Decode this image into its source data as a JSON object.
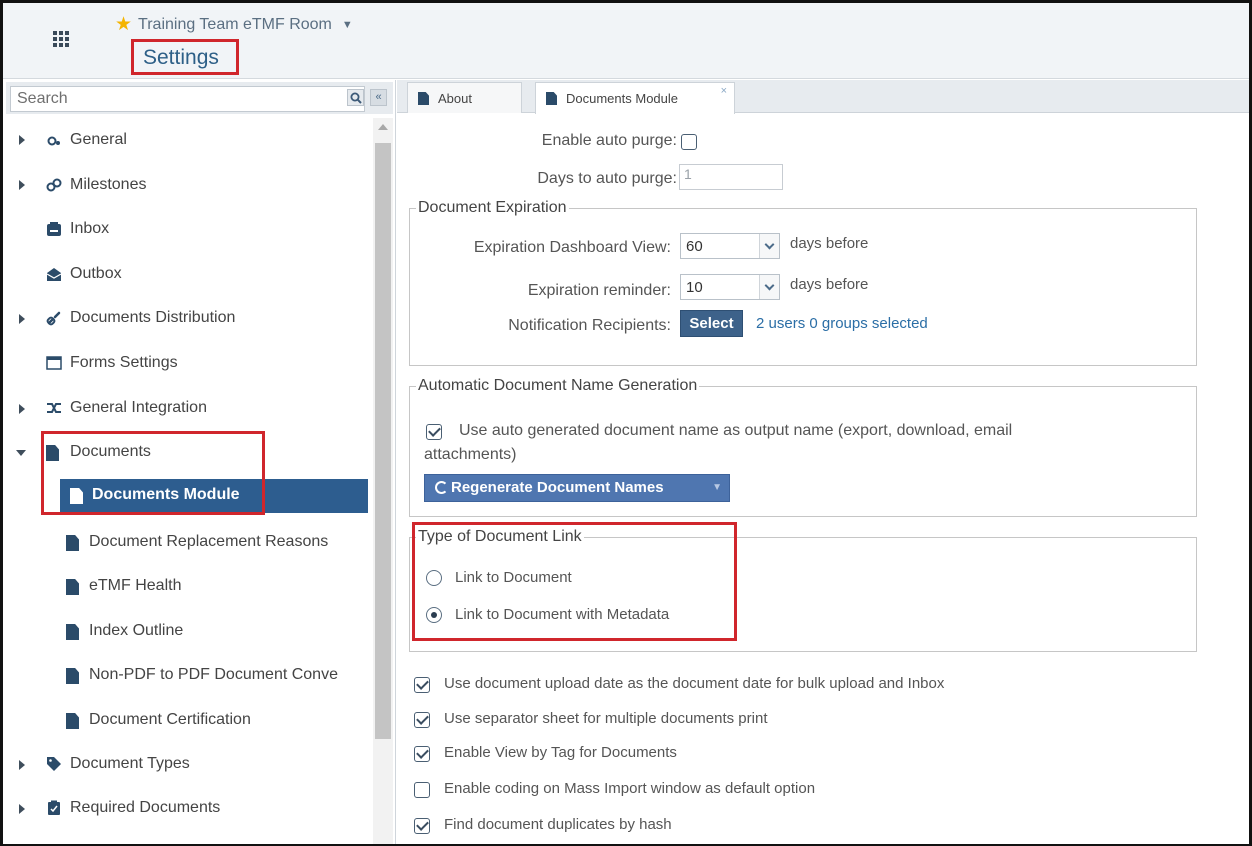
{
  "header": {
    "room_name": "Training Team eTMF Room",
    "page_title": "Settings"
  },
  "sidebar": {
    "search_placeholder": "Search",
    "items": [
      {
        "label": "General",
        "expandable": true
      },
      {
        "label": "Milestones",
        "expandable": true
      },
      {
        "label": "Inbox",
        "expandable": false
      },
      {
        "label": "Outbox",
        "expandable": false
      },
      {
        "label": "Documents Distribution",
        "expandable": true
      },
      {
        "label": "Forms Settings",
        "expandable": false
      },
      {
        "label": "General Integration",
        "expandable": true
      },
      {
        "label": "Documents",
        "expandable": true,
        "expanded": true
      },
      {
        "label": "Documents Module",
        "child": true,
        "selected": true
      },
      {
        "label": "Document Replacement Reasons",
        "child": true
      },
      {
        "label": "eTMF Health",
        "child": true
      },
      {
        "label": "Index Outline",
        "child": true
      },
      {
        "label": "Non-PDF to PDF Document Conve",
        "child": true
      },
      {
        "label": "Document Certification",
        "child": true
      },
      {
        "label": "Document Types",
        "expandable": true
      },
      {
        "label": "Required Documents",
        "expandable": true
      }
    ]
  },
  "tabs": [
    {
      "label": "About"
    },
    {
      "label": "Documents Module",
      "active": true,
      "close_glyph": "×"
    }
  ],
  "form": {
    "auto_purge_label": "Enable auto purge:",
    "auto_purge_checked": false,
    "days_purge_label": "Days to auto purge:",
    "days_purge_value": "1",
    "expiration": {
      "legend": "Document Expiration",
      "dashboard_label": "Expiration Dashboard View:",
      "dashboard_value": "60",
      "dashboard_unit": "days before",
      "reminder_label": "Expiration reminder:",
      "reminder_value": "10",
      "reminder_unit": "days before",
      "recipients_label": "Notification Recipients:",
      "select_button": "Select",
      "recipients_summary": "2 users 0 groups selected"
    },
    "name_generation": {
      "legend": "Automatic Document Name Generation",
      "auto_name_label": "Use auto generated document name as output name (export, download, email",
      "auto_name_label_cont": "attachments)",
      "auto_name_checked": true,
      "regenerate_button": "Regenerate Document Names"
    },
    "link_type": {
      "legend": "Type of Document Link",
      "options": [
        {
          "label": "Link to Document",
          "selected": false
        },
        {
          "label": "Link to Document with Metadata",
          "selected": true
        }
      ]
    },
    "options": [
      {
        "label": "Use document upload date as the document date for bulk upload and Inbox",
        "checked": true
      },
      {
        "label": "Use separator sheet for multiple documents print",
        "checked": true
      },
      {
        "label": "Enable View by Tag for Documents",
        "checked": true
      },
      {
        "label": "Enable coding on Mass Import window as default option",
        "checked": false
      },
      {
        "label": "Find document duplicates by hash",
        "checked": true
      }
    ]
  },
  "colors": {
    "selection": "#2d5d8f",
    "accent_button": "#3d628a",
    "highlight_box": "#d0262c",
    "link": "#2b6ea6"
  }
}
